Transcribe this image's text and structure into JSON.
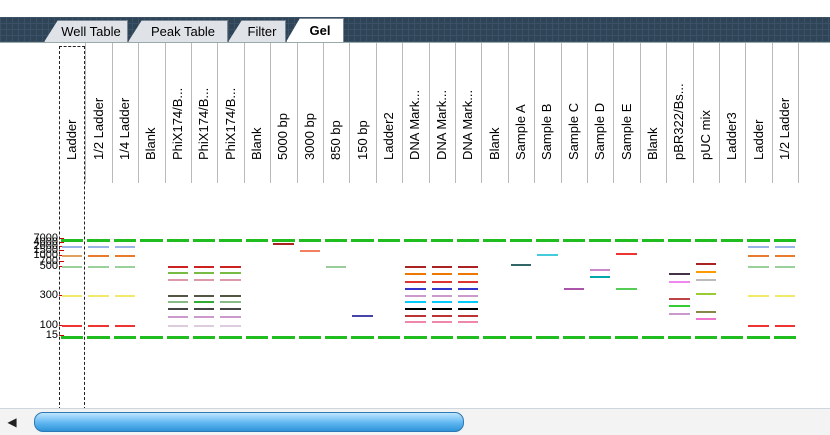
{
  "tabs": [
    {
      "label": "Well Table",
      "active": false
    },
    {
      "label": "Peak Table",
      "active": false
    },
    {
      "label": "Filter",
      "active": false
    },
    {
      "label": "Gel",
      "active": true
    }
  ],
  "lanes": [
    "Ladder",
    "1/2 Ladder",
    "1/4 Ladder",
    "Blank",
    "PhiX174/B...",
    "PhiX174/B...",
    "PhiX174/B...",
    "Blank",
    "5000 bp",
    "3000 bp",
    "850 bp",
    "150 bp",
    "Ladder2",
    "DNA Mark...",
    "DNA Mark...",
    "DNA Mark...",
    "Blank",
    "Sample A",
    "Sample B",
    "Sample C",
    "Sample D",
    "Sample E",
    "Blank",
    "pBR322/Bs...",
    "pUC mix",
    "Ladder3",
    "Ladder",
    "1/2 Ladder"
  ],
  "size_markers": [
    "7000",
    "4000",
    "2000",
    "1500",
    "1000",
    "700",
    "500",
    "300",
    "100",
    "15"
  ],
  "colors": {
    "marker_upper": "#1fbd1f",
    "marker_lower": "#1fbd1f",
    "tab_bar": "#2f4457",
    "scroll_thumb": "#4aa8e8"
  }
}
